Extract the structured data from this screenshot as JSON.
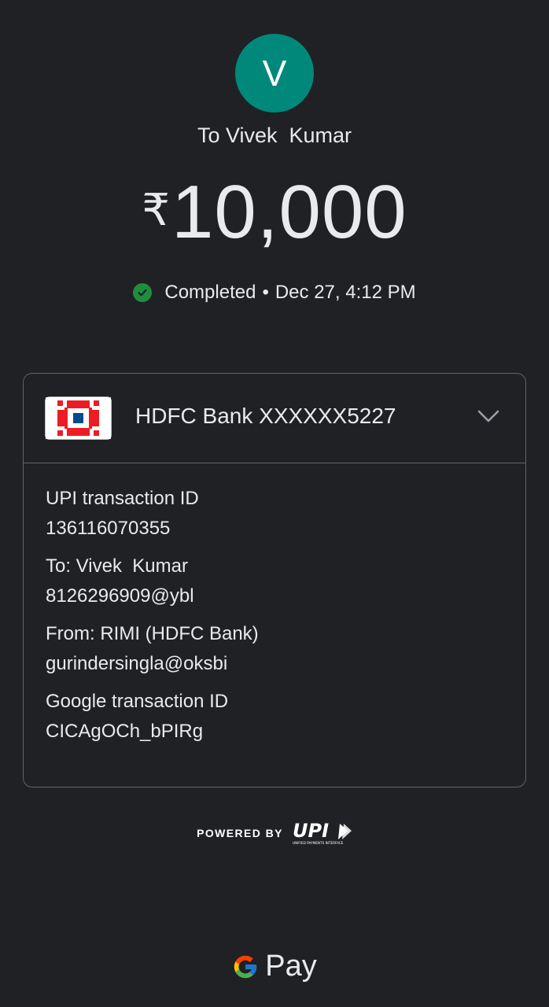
{
  "avatar": {
    "initial": "V",
    "color": "#00897b"
  },
  "recipient": {
    "to_label": "To Vivek  Kumar"
  },
  "payment": {
    "currency_symbol": "₹",
    "amount": "10,000",
    "status": "Completed",
    "separator": "•",
    "datetime": "Dec 27, 4:12 PM",
    "status_color": "#1e8e3e"
  },
  "bank": {
    "name": "HDFC Bank XXXXXX5227",
    "logo_icon": "hdfc-bank-logo",
    "expand_icon": "chevron-down-icon"
  },
  "details": [
    {
      "label": "UPI transaction ID",
      "value": "136116070355"
    },
    {
      "label": "To: Vivek  Kumar",
      "value": "8126296909@ybl"
    },
    {
      "label": "From: RIMI (HDFC Bank)",
      "value": "gurindersingla@oksbi"
    },
    {
      "label": "Google transaction ID",
      "value": "CICAgOCh_bPIRg"
    }
  ],
  "footer": {
    "powered_by": "POWERED BY",
    "upi_logo_text": "UPI",
    "upi_tagline": "UNIFIED PAYMENTS INTERFACE",
    "brand": "Pay"
  }
}
